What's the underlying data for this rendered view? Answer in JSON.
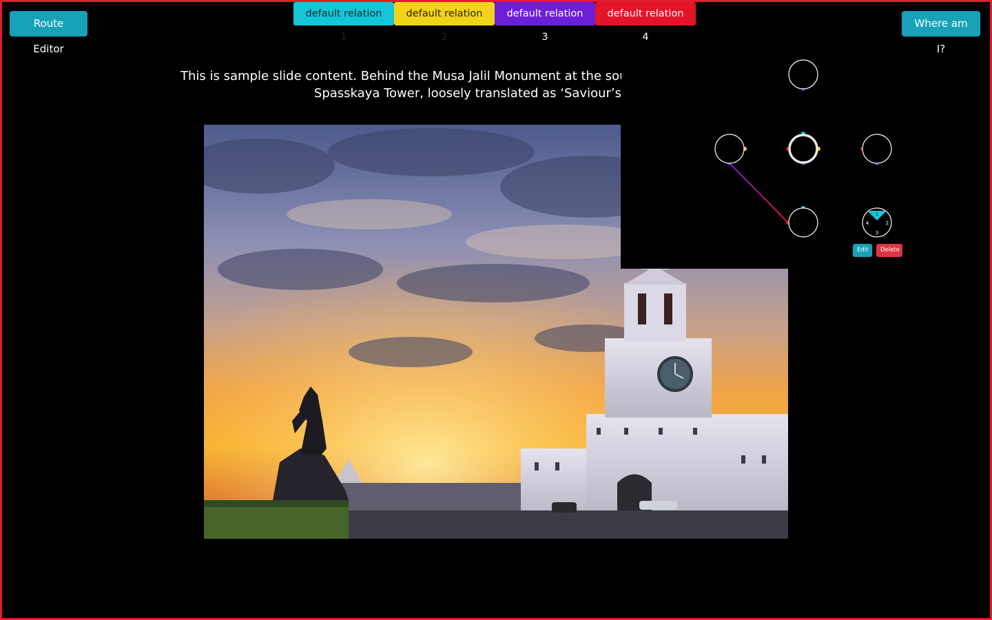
{
  "toolbar": {
    "route_editor_label": "Route Editor",
    "where_am_i_label": "Where am I?"
  },
  "relations": [
    {
      "label": "default relation 1",
      "color": "#17c5d8"
    },
    {
      "label": "default relation 2",
      "color": "#f2d31c"
    },
    {
      "label": "default relation 3",
      "color": "#6c1fd6"
    },
    {
      "label": "default relation 4",
      "color": "#e3142a"
    }
  ],
  "slide": {
    "text_line_1": "This is sample slide content. Behind the Musa Jalil Monument at the sou",
    "text_line_2": "Spasskaya Tower, loosely translated as ‘Saviour’s"
  },
  "graph": {
    "selected_node_ports": [
      "1",
      "2",
      "3",
      "4"
    ],
    "edit_label": "Edit",
    "delete_label": "Delete"
  },
  "colors": {
    "accent": "#17a2b8",
    "danger": "#dc3545",
    "frame_border": "#e11d2a"
  }
}
